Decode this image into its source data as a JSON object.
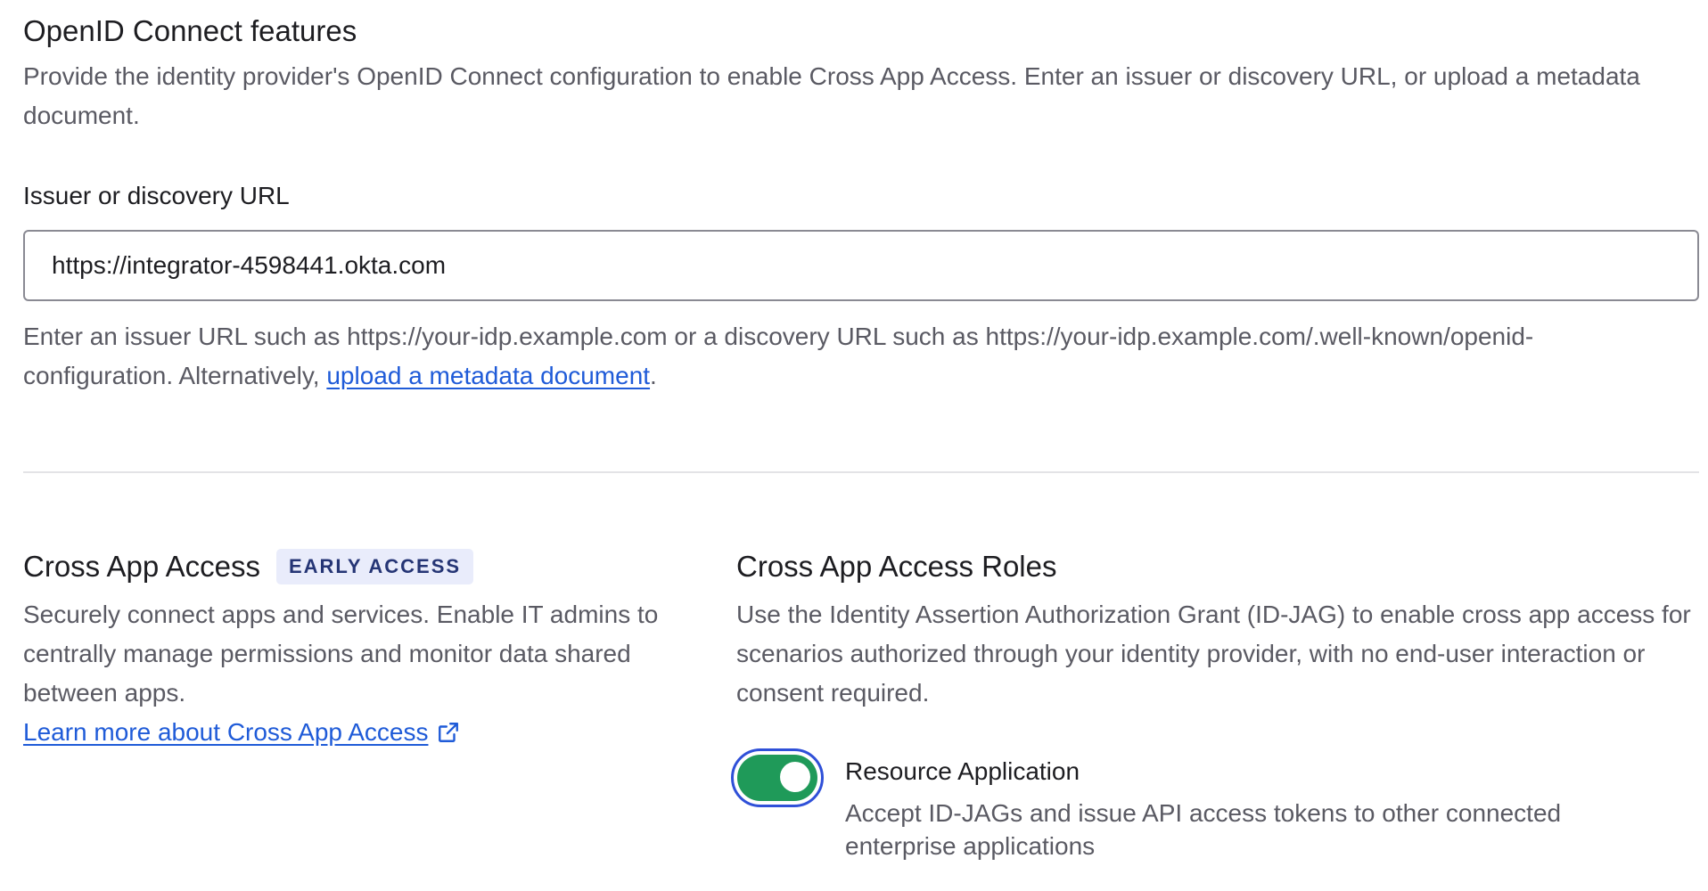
{
  "oidc": {
    "title": "OpenID Connect features",
    "description": "Provide the identity provider's OpenID Connect configuration to enable Cross App Access. Enter an issuer or discovery URL, or upload a metadata document.",
    "field_label": "Issuer or discovery URL",
    "field_value": "https://integrator-4598441.okta.com",
    "hint_prefix": "Enter an issuer URL such as https://your-idp.example.com or a discovery URL such as https://your-idp.example.com/.well-known/openid-configuration. Alternatively, ",
    "hint_link": "upload a metadata document",
    "hint_suffix": "."
  },
  "cross_app": {
    "title": "Cross App Access",
    "badge": "EARLY ACCESS",
    "description": "Securely connect apps and services. Enable IT admins to centrally manage permissions and monitor data shared between apps.",
    "learn_more": "Learn more about Cross App Access",
    "learn_more_icon": "external-link-icon"
  },
  "roles": {
    "title": "Cross App Access Roles",
    "description": "Use the Identity Assertion Authorization Grant (ID-JAG) to enable cross app access for scenarios authorized through your identity provider, with no end-user interaction or consent required.",
    "resource_app": {
      "label": "Resource Application",
      "description": "Accept ID-JAGs and issue API access tokens to other connected enterprise applications",
      "enabled": true
    }
  },
  "colors": {
    "link": "#1f5bd8",
    "toggle_on": "#1f9a59",
    "focus_ring": "#2f50d8",
    "badge_bg": "#e9ecfb",
    "badge_text": "#253575"
  }
}
